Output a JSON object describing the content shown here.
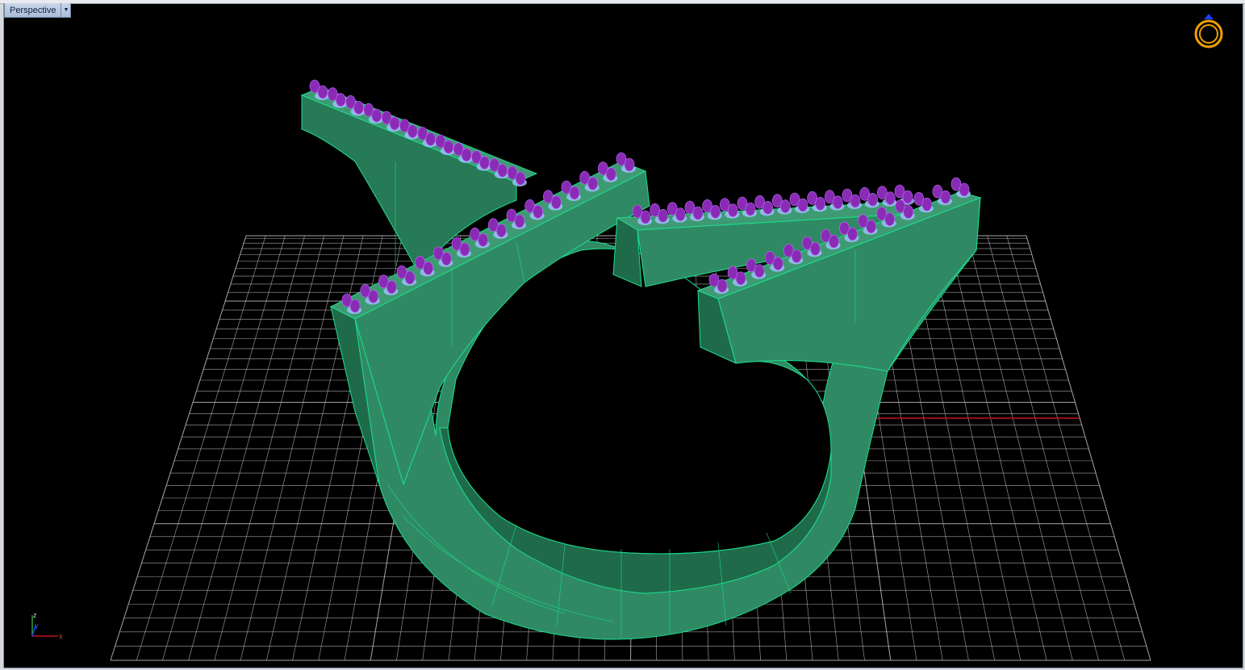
{
  "viewport": {
    "label": "Perspective",
    "dropdown_icon": "chevron-down-icon"
  },
  "axis_labels": {
    "z": "z",
    "y": "y",
    "x": "x"
  },
  "colors": {
    "background": "#000000",
    "grid": "#cfcfcf",
    "ring_fill": "#2f8a63",
    "ring_edge": "#1be08f",
    "gem": "#8a2bb5",
    "setting": "#9fc4ff",
    "x_axis": "#c0141c",
    "y_axis": "#1a3cff",
    "logo": "#f0a000"
  },
  "logo_icon": "ring-diamond-icon"
}
